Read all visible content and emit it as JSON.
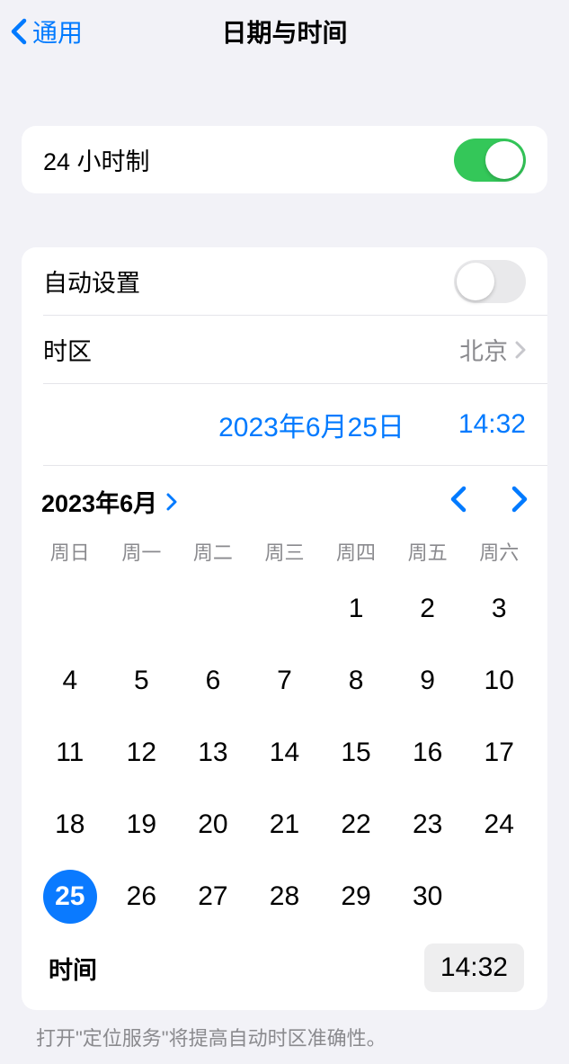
{
  "navbar": {
    "back": "通用",
    "title": "日期与时间"
  },
  "group1": {
    "twentyFourHour": {
      "label": "24 小时制",
      "on": true
    }
  },
  "group2": {
    "autoSet": {
      "label": "自动设置",
      "on": false
    },
    "timezone": {
      "label": "时区",
      "value": "北京"
    },
    "selectedDateDisplay": "2023年6月25日",
    "selectedTimeDisplay": "14:32"
  },
  "calendar": {
    "monthLabel": "2023年6月",
    "weekdays": [
      "周日",
      "周一",
      "周二",
      "周三",
      "周四",
      "周五",
      "周六"
    ],
    "leadingBlanks": 4,
    "daysInMonth": 30,
    "selectedDay": 25
  },
  "timeRow": {
    "label": "时间",
    "value": "14:32"
  },
  "footer": "打开\"定位服务\"将提高自动时区准确性。"
}
